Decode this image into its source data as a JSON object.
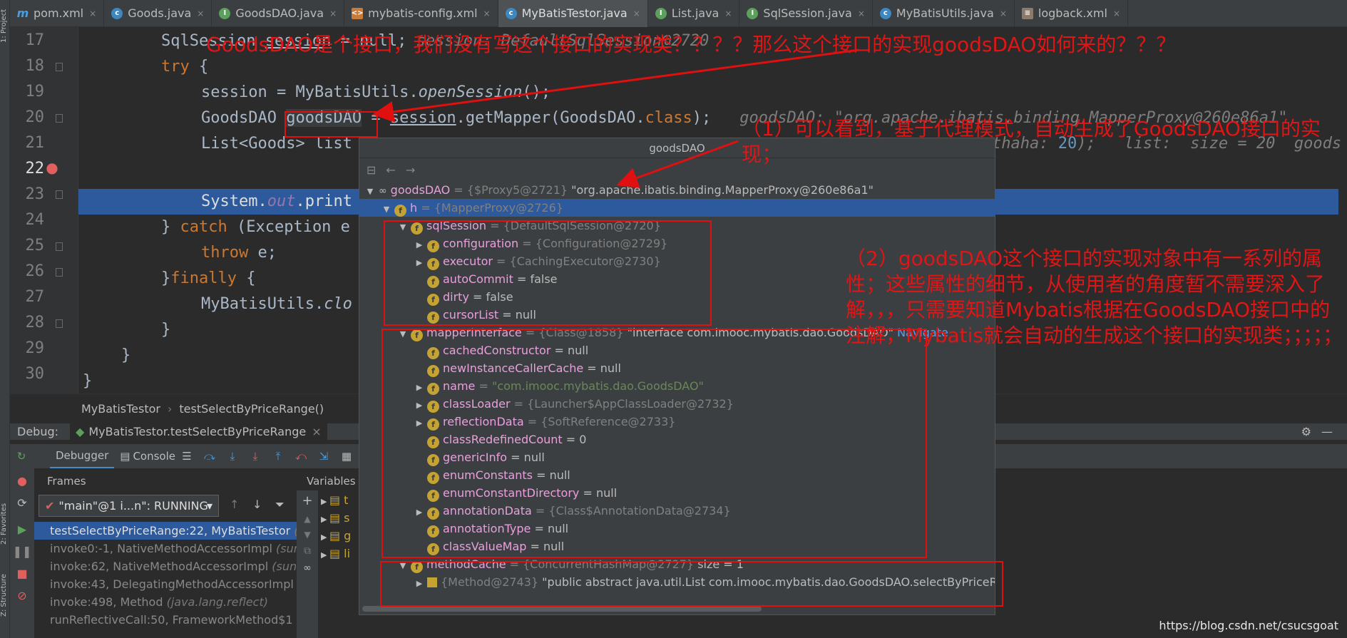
{
  "tabs": [
    {
      "label": "pom.xml",
      "icon": "m"
    },
    {
      "label": "Goods.java",
      "icon": "c"
    },
    {
      "label": "GoodsDAO.java",
      "icon": "i"
    },
    {
      "label": "mybatis-config.xml",
      "icon": "x"
    },
    {
      "label": "MyBatisTestor.java",
      "icon": "c",
      "active": true
    },
    {
      "label": "List.java",
      "icon": "i"
    },
    {
      "label": "SqlSession.java",
      "icon": "i"
    },
    {
      "label": "MyBatisUtils.java",
      "icon": "c"
    },
    {
      "label": "logback.xml",
      "icon": "l"
    }
  ],
  "side_labels": {
    "project": "1: Project",
    "favorites": "2: Favorites",
    "structure": "Z: Structure"
  },
  "line_numbers": [
    "17",
    "18",
    "19",
    "20",
    "21",
    "22",
    "23",
    "24",
    "25",
    "26",
    "27",
    "28",
    "29",
    "30"
  ],
  "code": {
    "l17_a": "SqlSession ",
    "l17_b": "session",
    "l17_c": " = null; ",
    "l17_hint": "session: DefaultSqlSession@2720",
    "l18_kw": "try",
    "l18_b": " {",
    "l19_a": "session",
    "l19_b": " = MyBatisUtils.",
    "l19_c": "openSession",
    "l19_d": "();",
    "l20_a": "GoodsDAO ",
    "l20_b": "goodsDAO",
    "l20_c": " = ",
    "l20_d": "session",
    "l20_e": ".getMapper(GoodsDAO.",
    "l20_f": "class",
    "l20_g": ");",
    "l20_hint": "goodsDAO: \"org.apache.ibatis.binding.MapperProxy@260e86a1\"",
    "l21_a": "List<Goods> list",
    "l21_hint_a": "thaha: ",
    "l21_hint_num": "20",
    "l21_hint_b": ");   list:  size = 20  goods",
    "l22_a": "System.",
    "l22_b": "out",
    "l22_c": ".print",
    "l23_a": "} ",
    "l23_kw": "catch",
    "l23_b": " (Exception e",
    "l24_kw": "throw",
    "l24_b": " e;",
    "l25_a": "}",
    "l25_kw": "finally",
    "l25_b": " {",
    "l26_a": "MyBatisUtils.",
    "l26_b": "clo",
    "l27": "}",
    "l28": "}",
    "l29": "}"
  },
  "breadcrumb": {
    "class": "MyBatisTestor",
    "method": "testSelectByPriceRange()"
  },
  "debug": {
    "label": "Debug:",
    "session_tab": "MyBatisTestor.testSelectByPriceRange",
    "debugger_tab": "Debugger",
    "console_tab": "Console",
    "frames_header": "Frames",
    "variables_header": "Variables",
    "thread": "\"main\"@1 i...n\": RUNNING",
    "frames": [
      {
        "method": "testSelectByPriceRange:22, MyBatisTestor",
        "pkg": "(com",
        "active": true
      },
      {
        "method": "invoke0:-1, NativeMethodAccessorImpl",
        "pkg": "(sun.re"
      },
      {
        "method": "invoke:62, NativeMethodAccessorImpl",
        "pkg": "(sun.refl"
      },
      {
        "method": "invoke:43, DelegatingMethodAccessorImpl",
        "pkg": "(su"
      },
      {
        "method": "invoke:498, Method",
        "pkg": "(java.lang.reflect)"
      },
      {
        "method": "runReflectiveCall:50, FrameworkMethod$1",
        "pkg": "(org"
      }
    ],
    "var_initials": [
      "t",
      "s",
      "g",
      "li"
    ]
  },
  "popup": {
    "title": "goodsDAO",
    "rows": [
      {
        "indent": 0,
        "tri": "open",
        "icon": "oo",
        "name": "goodsDAO",
        "type": " = {$Proxy5@2721} ",
        "value": "\"org.apache.ibatis.binding.MapperProxy@260e86a1\""
      },
      {
        "indent": 1,
        "tri": "open",
        "icon": "f",
        "name": "h",
        "type": " = {MapperProxy@2726}",
        "value": "",
        "sel": true
      },
      {
        "indent": 2,
        "tri": "open",
        "icon": "f",
        "name": "sqlSession",
        "type": " = {DefaultSqlSession@2720}",
        "value": ""
      },
      {
        "indent": 3,
        "tri": "closed",
        "icon": "f",
        "name": "configuration",
        "type": " = {Configuration@2729}",
        "value": ""
      },
      {
        "indent": 3,
        "tri": "closed",
        "icon": "f",
        "name": "executor",
        "type": " = {CachingExecutor@2730}",
        "value": ""
      },
      {
        "indent": 3,
        "tri": "none",
        "icon": "f",
        "name": "autoCommit",
        "type": "",
        "value": " = false"
      },
      {
        "indent": 3,
        "tri": "none",
        "icon": "f",
        "name": "dirty",
        "type": "",
        "value": " = false"
      },
      {
        "indent": 3,
        "tri": "none",
        "icon": "f",
        "name": "cursorList",
        "type": "",
        "value": " = null"
      },
      {
        "indent": 2,
        "tri": "open",
        "icon": "f",
        "name": "mapperInterface",
        "type": " = {Class@1858} ",
        "value": "\"interface com.imooc.mybatis.dao.GoodsDAO\"",
        "link": " Navigate"
      },
      {
        "indent": 3,
        "tri": "none",
        "icon": "f",
        "name": "cachedConstructor",
        "type": "",
        "value": " = null"
      },
      {
        "indent": 3,
        "tri": "none",
        "icon": "f",
        "name": "newInstanceCallerCache",
        "type": "",
        "value": " = null"
      },
      {
        "indent": 3,
        "tri": "closed",
        "icon": "f",
        "name": "name",
        "type": " = ",
        "str": "\"com.imooc.mybatis.dao.GoodsDAO\""
      },
      {
        "indent": 3,
        "tri": "closed",
        "icon": "f",
        "name": "classLoader",
        "type": " = {Launcher$AppClassLoader@2732}",
        "value": ""
      },
      {
        "indent": 3,
        "tri": "closed",
        "icon": "f",
        "name": "reflectionData",
        "type": " = {SoftReference@2733}",
        "value": ""
      },
      {
        "indent": 3,
        "tri": "none",
        "icon": "f",
        "name": "classRedefinedCount",
        "type": "",
        "value": " = 0"
      },
      {
        "indent": 3,
        "tri": "none",
        "icon": "f",
        "name": "genericInfo",
        "type": "",
        "value": " = null"
      },
      {
        "indent": 3,
        "tri": "none",
        "icon": "f",
        "name": "enumConstants",
        "type": "",
        "value": " = null"
      },
      {
        "indent": 3,
        "tri": "none",
        "icon": "f",
        "name": "enumConstantDirectory",
        "type": "",
        "value": " = null"
      },
      {
        "indent": 3,
        "tri": "closed",
        "icon": "f",
        "name": "annotationData",
        "type": " = {Class$AnnotationData@2734}",
        "value": ""
      },
      {
        "indent": 3,
        "tri": "none",
        "icon": "f",
        "name": "annotationType",
        "type": "",
        "value": " = null"
      },
      {
        "indent": 3,
        "tri": "none",
        "icon": "f",
        "name": "classValueMap",
        "type": "",
        "value": " = null"
      },
      {
        "indent": 2,
        "tri": "open",
        "icon": "f",
        "name": "methodCache",
        "type": " = {ConcurrentHashMap@2727}",
        "value": "  size = 1"
      },
      {
        "indent": 3,
        "tri": "closed",
        "icon": "list",
        "name": "",
        "type": "{Method@2743} ",
        "value": "\"public abstract java.util.List com.imooc.mybatis.dao.GoodsDAO.selectByPriceRan",
        "link": "... View"
      }
    ]
  },
  "annotations": {
    "top": "GoodsDAO是个接口，我们没有写这个接口的实现类？？？？那么这个接口的实现goodsDAO如何来的？？？",
    "note1": "（1）可以看到，基于代理模式，自动生成了GoodsDAO接口的实现；",
    "note2": "（2）goodsDAO这个接口的实现对象中有一系列的属性；这些属性的细节，从使用者的角度暂不需要深入了解，，，只需要知道Mybatis根据在GoodsDAO接口中的注解，Mybatis就会自动的生成这个接口的实现类；；；；；"
  },
  "watermark": "https://blog.csdn.net/csucsgoat",
  "colors": {
    "annotation_red": "#e01010",
    "selection_blue": "#2d5a9c",
    "keyword_orange": "#cc7832"
  }
}
